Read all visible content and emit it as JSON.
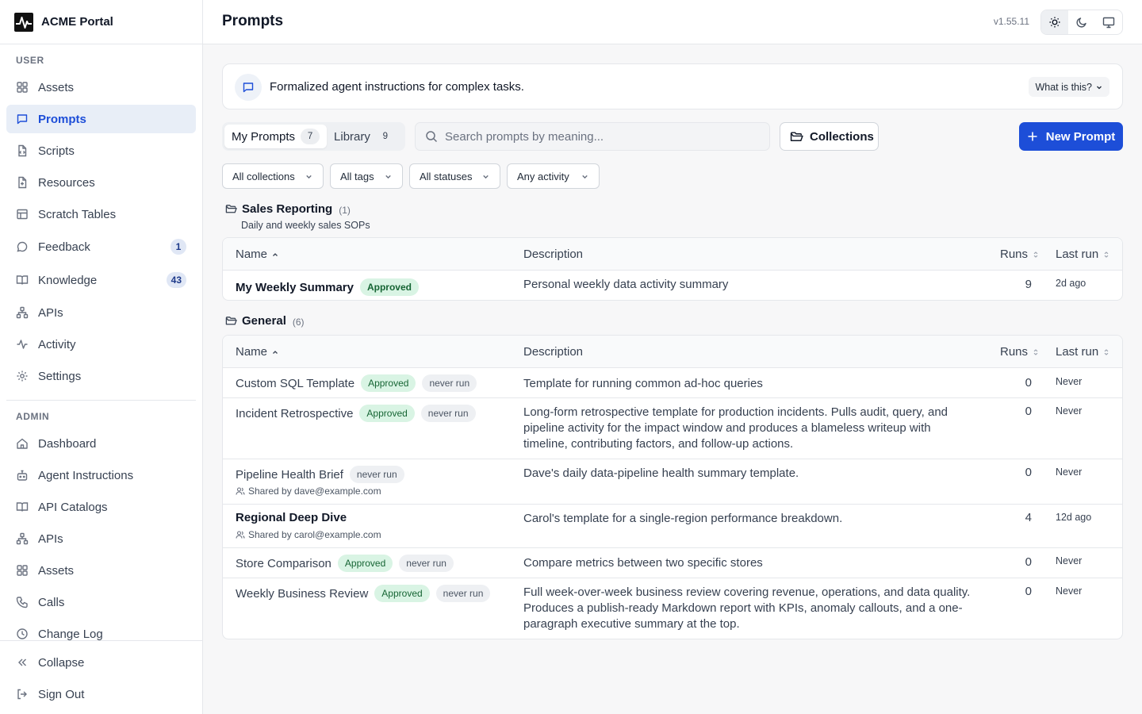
{
  "app": {
    "name": "ACME Portal"
  },
  "sidebar": {
    "user_label": "USER",
    "user_items": [
      {
        "label": "Assets",
        "icon": "grid-icon"
      },
      {
        "label": "Prompts",
        "icon": "message-square-icon",
        "active": true
      },
      {
        "label": "Scripts",
        "icon": "file-code-icon"
      },
      {
        "label": "Resources",
        "icon": "file-plus-icon"
      },
      {
        "label": "Scratch Tables",
        "icon": "table-icon"
      },
      {
        "label": "Feedback",
        "icon": "message-circle-icon",
        "badge": "1"
      },
      {
        "label": "Knowledge",
        "icon": "book-open-icon",
        "badge": "43"
      },
      {
        "label": "APIs",
        "icon": "network-icon"
      },
      {
        "label": "Activity",
        "icon": "activity-icon"
      },
      {
        "label": "Settings",
        "icon": "gear-icon"
      }
    ],
    "admin_label": "ADMIN",
    "admin_items": [
      {
        "label": "Dashboard",
        "icon": "home-icon"
      },
      {
        "label": "Agent Instructions",
        "icon": "bot-icon"
      },
      {
        "label": "API Catalogs",
        "icon": "book-open-icon"
      },
      {
        "label": "APIs",
        "icon": "network-icon"
      },
      {
        "label": "Assets",
        "icon": "grid-icon"
      },
      {
        "label": "Calls",
        "icon": "phone-icon"
      },
      {
        "label": "Change Log",
        "icon": "clock-icon"
      }
    ],
    "footer": {
      "collapse": "Collapse",
      "sign_out": "Sign Out"
    }
  },
  "header": {
    "title": "Prompts",
    "version": "v1.55.11"
  },
  "banner": {
    "text": "Formalized agent instructions for complex tasks.",
    "button": "What is this?"
  },
  "toolbar": {
    "tabs": [
      {
        "label": "My Prompts",
        "count": "7",
        "active": true
      },
      {
        "label": "Library",
        "count": "9"
      }
    ],
    "search_placeholder": "Search prompts by meaning...",
    "collections": "Collections",
    "new_prompt": "New Prompt"
  },
  "filters": [
    "All collections",
    "All tags",
    "All statuses",
    "Any activity"
  ],
  "columns": {
    "name": "Name",
    "description": "Description",
    "runs": "Runs",
    "last_run": "Last run"
  },
  "groups": [
    {
      "name": "Sales Reporting",
      "count": "(1)",
      "description": "Daily and weekly sales SOPs",
      "rows": [
        {
          "name": "My Weekly Summary",
          "bold": true,
          "badges": [
            "Approved"
          ],
          "description": [
            "Personal weekly data activity summary"
          ],
          "runs": "9",
          "last_run": "2d ago"
        }
      ]
    },
    {
      "name": "General",
      "count": "(6)",
      "rows": [
        {
          "name": "Custom SQL Template",
          "badges": [
            "Approved",
            "never run"
          ],
          "description": [
            "Template for running common ad-hoc queries"
          ],
          "runs": "0",
          "last_run": "Never"
        },
        {
          "name": "Incident Retrospective",
          "badges": [
            "Approved",
            "never run"
          ],
          "description": [
            "Long-form retrospective template for production incidents. Pulls audit, query, and",
            "pipeline activity for the impact window and produces a blameless writeup with",
            "timeline, contributing factors, and follow-up actions."
          ],
          "runs": "0",
          "last_run": "Never"
        },
        {
          "name": "Pipeline Health Brief",
          "badges": [
            "never run"
          ],
          "shared": "Shared by dave@example.com",
          "description": [
            "Dave's daily data-pipeline health summary template."
          ],
          "runs": "0",
          "last_run": "Never"
        },
        {
          "name": "Regional Deep Dive",
          "bold": true,
          "badges": [],
          "shared": "Shared by carol@example.com",
          "description": [
            "Carol's template for a single-region performance breakdown."
          ],
          "runs": "4",
          "last_run": "12d ago"
        },
        {
          "name": "Store Comparison",
          "badges": [
            "Approved",
            "never run"
          ],
          "description": [
            "Compare metrics between two specific stores"
          ],
          "runs": "0",
          "last_run": "Never"
        },
        {
          "name": "Weekly Business Review",
          "badges": [
            "Approved",
            "never run"
          ],
          "description": [
            "Full week-over-week business review covering revenue, operations, and data quality.",
            "Produces a publish-ready Markdown report with KPIs, anomaly callouts, and a one-",
            "paragraph executive summary at the top."
          ],
          "runs": "0",
          "last_run": "Never"
        }
      ]
    }
  ],
  "colors": {
    "accent": "#1d4ed8",
    "approved_bg": "#d9f4e4",
    "approved_text": "#166534"
  }
}
